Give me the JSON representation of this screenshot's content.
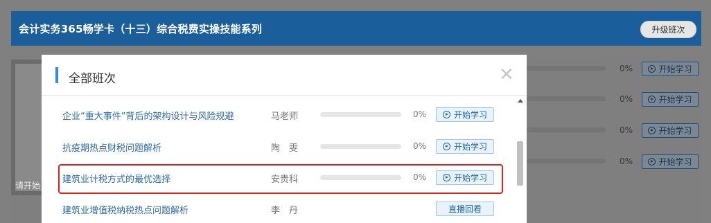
{
  "background": {
    "header_title": "会计实务365畅学卡（十三）综合税费实操技能系列",
    "upgrade_button": "升级班次",
    "thumb_caption": "请开始",
    "rows": [
      {
        "pct": "0%",
        "btn": "开始学习"
      },
      {
        "pct": "0%",
        "btn": "开始学习"
      },
      {
        "pct": "0%",
        "btn": "开始学习"
      },
      {
        "pct": "0%",
        "btn": "开始学习"
      }
    ]
  },
  "modal": {
    "title": "全部班次",
    "close_icon": "close-icon",
    "rows": [
      {
        "title": "企业“重大事件”背后的架构设计与风险规避",
        "teacher": "马老师",
        "pct": "0%",
        "progress": 0,
        "btn": "开始学习"
      },
      {
        "title": "抗疫期热点财税问题解析",
        "teacher": "陶　雯",
        "pct": "0%",
        "progress": 0,
        "btn": "开始学习"
      },
      {
        "title": "建筑业计税方式的最优选择",
        "teacher": "安贵科",
        "pct": "0%",
        "progress": 0,
        "btn": "开始学习"
      },
      {
        "title": "建筑业增值税纳税热点问题解析",
        "teacher": "李　丹",
        "btn": "直播回看"
      }
    ]
  },
  "colors": {
    "accent": "#2d8cf0",
    "link": "#2b6cb0",
    "highlight": "#e0201b",
    "header": "#1a5e9b"
  }
}
